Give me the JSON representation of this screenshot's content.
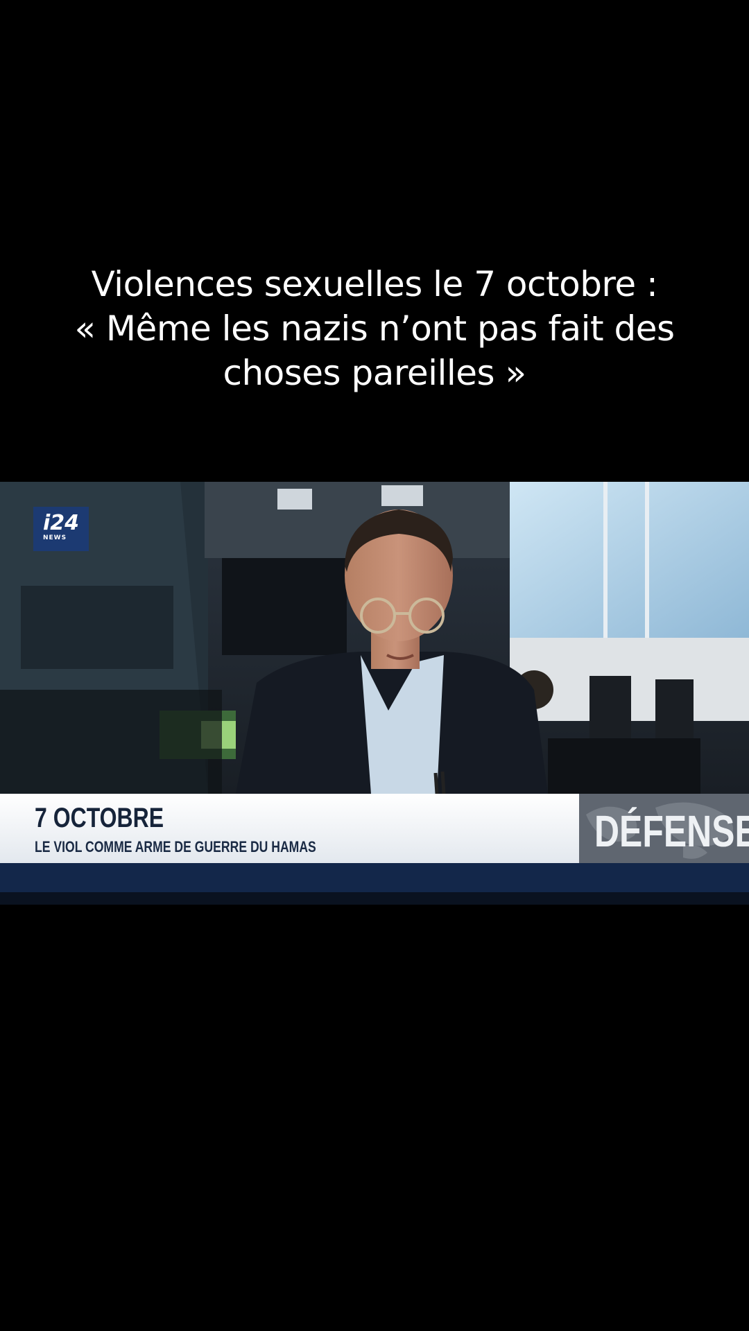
{
  "caption": {
    "line1": "Violences sexuelles le 7 octobre :",
    "line2": "« Même les nazis n’ont pas fait des",
    "line3": "choses pareilles »"
  },
  "video": {
    "channel_logo": {
      "main": "i24",
      "sub": "NEWS"
    },
    "lower_third": {
      "title": "7 OCTOBRE",
      "subtitle": "LE VIOL COMME ARME DE GUERRE DU HAMAS"
    },
    "section_tag": "DÉFENSE",
    "colors": {
      "lower_third_bg": "#ffffff",
      "lower_third_text": "#16243a",
      "section_tag_bg": "#5f6670",
      "ticker_bar": "#13274a",
      "logo_bg": "#1c3a72"
    }
  }
}
